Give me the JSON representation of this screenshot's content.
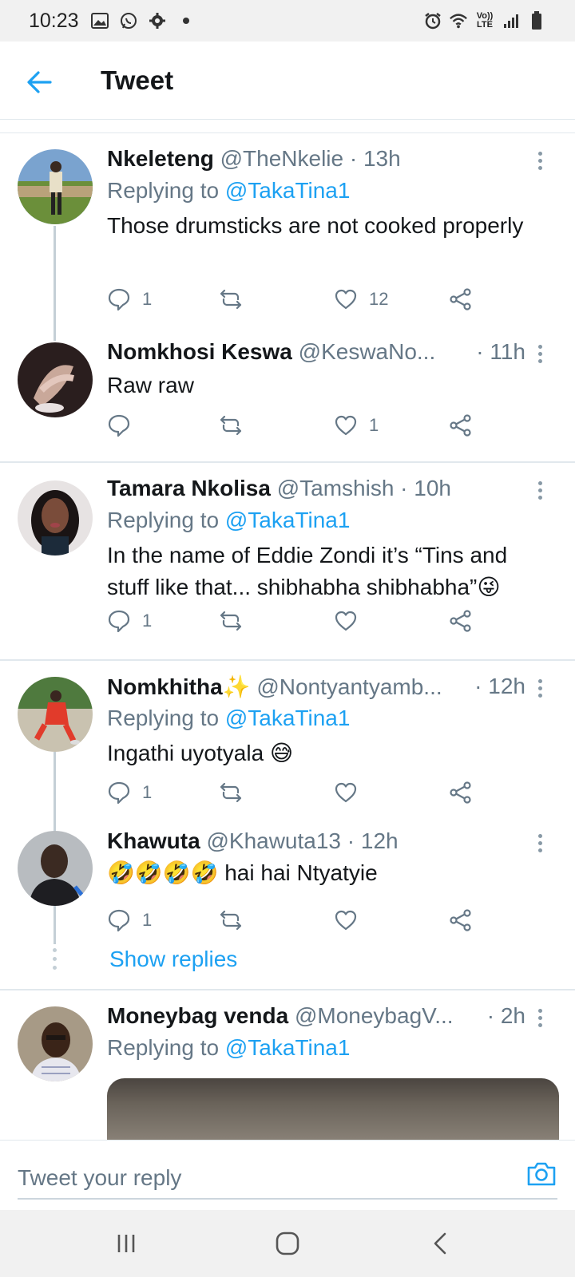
{
  "status_bar": {
    "time": "10:23",
    "network": "Vo)) LTE"
  },
  "app_bar": {
    "title": "Tweet"
  },
  "tweets": [
    {
      "name": "Nkeleteng",
      "handle": "@TheNkelie",
      "age": "· 13h",
      "replying_prefix": "Replying to",
      "replying_to": "@TakaTina1",
      "text": "Those drumsticks are not cooked properly",
      "reply_count": "1",
      "like_count": "12"
    },
    {
      "name": "Nomkhosi Keswa",
      "handle": "@KeswaNo...",
      "age": "· 11h",
      "text": "Raw raw",
      "reply_count": "",
      "like_count": "1"
    },
    {
      "name": "Tamara Nkolisa",
      "handle": "@Tamshish",
      "age": "· 10h",
      "replying_prefix": "Replying to",
      "replying_to": "@TakaTina1",
      "text": "In the name of Eddie Zondi it’s “Tins and stuff like that... shibhabha shibhabha”😜",
      "reply_count": "1",
      "like_count": ""
    },
    {
      "name": "Nomkhitha✨",
      "handle": "@Nontyantyamb...",
      "age": "· 12h",
      "replying_prefix": "Replying to",
      "replying_to": "@TakaTina1",
      "text": "Ingathi uyotyala 😅",
      "reply_count": "1",
      "like_count": ""
    },
    {
      "name": "Khawuta",
      "handle": "@Khawuta13",
      "age": "· 12h",
      "text": "🤣🤣🤣🤣 hai hai Ntyatyie",
      "reply_count": "1",
      "like_count": ""
    },
    {
      "name": "Moneybag venda",
      "handle": "@MoneybagV...",
      "age": "· 2h",
      "replying_prefix": "Replying to",
      "replying_to": "@TakaTina1"
    }
  ],
  "show_replies_label": "Show replies",
  "reply_bar": {
    "placeholder": "Tweet your reply"
  },
  "colors": {
    "accent": "#1da1f2",
    "secondary_text": "#657786",
    "divider": "#e1e8ed"
  }
}
